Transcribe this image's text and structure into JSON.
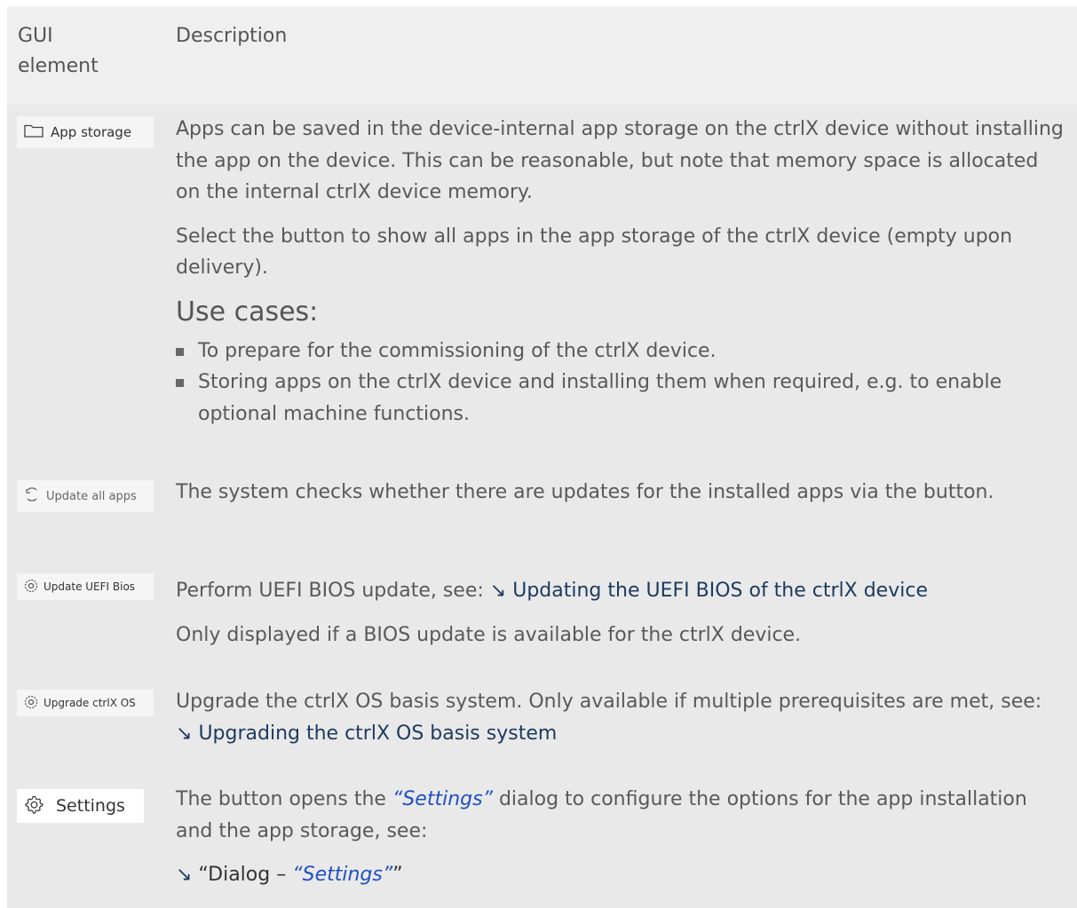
{
  "header": {
    "col1": "GUI element",
    "col1_line1": "GUI",
    "col1_line2": "element",
    "col2": "Description"
  },
  "rows": {
    "app_storage": {
      "button": "App storage",
      "icon": "folder-icon",
      "para1": "Apps can be saved in the device-internal app storage on the ctrlX device without installing the app on the device. This can be reasonable, but note that memory space is allocated on the internal ctrlX device memory.",
      "para2": "Select the button to show all apps in the app storage of the ctrlX device (empty upon delivery).",
      "use_cases_heading": "Use cases:",
      "bullets": [
        "To prepare for the commissioning of the ctrlX device.",
        "Storing apps on the ctrlX device and installing them when required, e.g. to enable optional machine functions."
      ]
    },
    "update_all": {
      "button": "Update all apps",
      "icon": "refresh-icon",
      "para1": "The system checks whether there are updates for the installed apps via the button."
    },
    "uefi": {
      "button": "Update UEFI Bios",
      "icon": "update-gear-icon",
      "para1_prefix": "Perform UEFI BIOS update, see: ",
      "link_arrow": "↘",
      "link": "Updating the UEFI BIOS of the ctrlX device",
      "para2": "Only displayed if a BIOS update is available for the ctrlX device."
    },
    "upgrade": {
      "button": "Upgrade ctrlX OS",
      "icon": "update-gear-icon",
      "para1_prefix": "Upgrade the ctrlX OS basis system. Only available if multiple prerequisites are met, see: ",
      "link_arrow": "↘",
      "link": "Upgrading the ctrlX OS basis system"
    },
    "settings": {
      "button": "Settings",
      "icon": "gear-icon",
      "para1_prefix": "The button opens the ",
      "para1_ital": "“Settings”",
      "para1_suffix": " dialog to configure the options for the app installation and the app storage, see:",
      "link_arrow": "↘",
      "link_prefix": " “Dialog – ",
      "link_ital": "“Settings”",
      "link_suffix": "”"
    }
  }
}
